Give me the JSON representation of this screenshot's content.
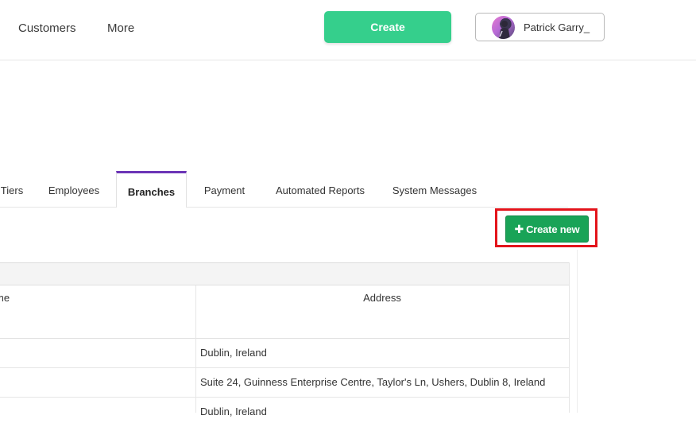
{
  "nav": {
    "customers": "Customers",
    "more": "More",
    "create": "Create",
    "user_name": "Patrick Garry_"
  },
  "tabs": [
    {
      "label": "Tiers"
    },
    {
      "label": "Employees"
    },
    {
      "label": "Branches",
      "active": true
    },
    {
      "label": "Payment"
    },
    {
      "label": "Automated Reports"
    },
    {
      "label": "System Messages"
    }
  ],
  "toolbar": {
    "create_new": "Create new"
  },
  "table": {
    "columns": [
      "me",
      "Address"
    ],
    "rows": [
      {
        "address": "Dublin, Ireland"
      },
      {
        "address": "Suite 24, Guinness Enterprise Centre, Taylor's Ln, Ushers, Dublin 8, Ireland"
      },
      {
        "address": "Dublin, Ireland"
      }
    ]
  },
  "colors": {
    "create_top": "#35cf8c",
    "create_new": "#19a357",
    "active_tab": "#6c35b6",
    "highlight": "#e3141b"
  }
}
